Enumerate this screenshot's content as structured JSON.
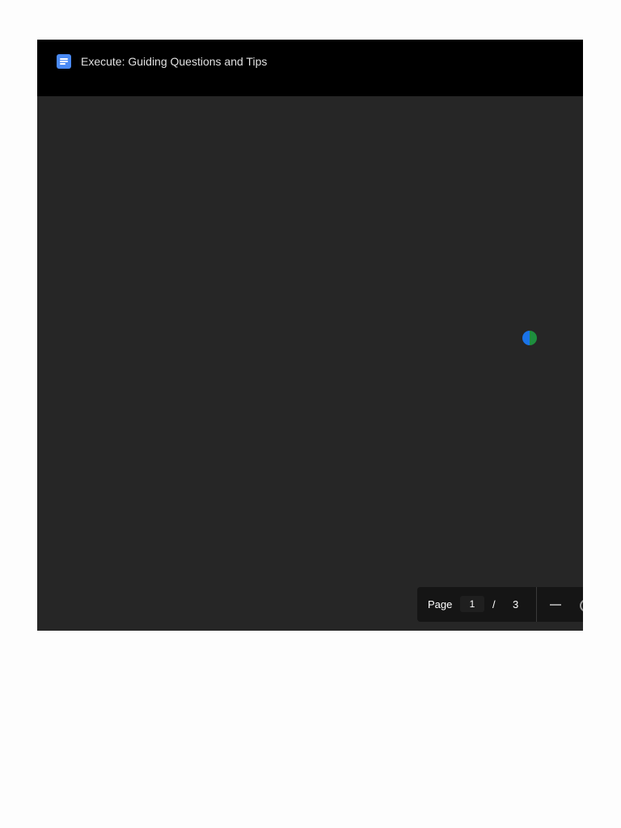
{
  "header": {
    "title": "Execute: Guiding Questions and Tips",
    "icon": "google-docs-icon"
  },
  "viewer": {
    "loading_icon": "loading-spinner-icon",
    "colors": {
      "spinner_blue": "#1a73e8",
      "spinner_green": "#1e8e3e"
    }
  },
  "pager": {
    "label": "Page",
    "current": "1",
    "separator": "/",
    "total": "3",
    "zoom_out_icon": "zoom-out-icon",
    "zoom_in_icon": "zoom-in-icon"
  },
  "colors": {
    "title_bar": "#000000",
    "viewer_background": "#262626",
    "docs_icon": "#4a8af4"
  }
}
